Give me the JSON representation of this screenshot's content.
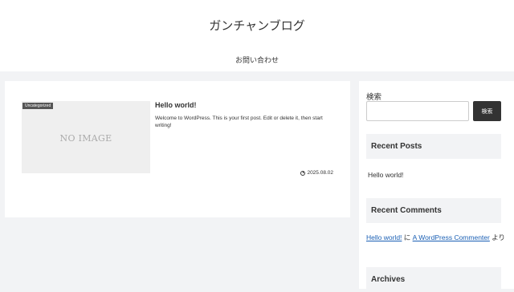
{
  "header": {
    "site_title": "ガンチャンブログ",
    "nav_items": [
      "お問い合わせ"
    ]
  },
  "posts": [
    {
      "category": "Uncategorized",
      "thumbnail_text": "NO IMAGE",
      "title": "Hello world!",
      "excerpt": "Welcome to WordPress. This is your first post. Edit or delete it, then start writing!",
      "date": "2025.08.02"
    }
  ],
  "sidebar": {
    "search": {
      "label": "検索",
      "placeholder": "",
      "button_label": "検索"
    },
    "recent_posts": {
      "heading": "Recent Posts",
      "items": [
        "Hello world!"
      ]
    },
    "recent_comments": {
      "heading": "Recent Comments",
      "items": [
        {
          "post_link": "Hello world!",
          "connector": " に ",
          "author_link": "A WordPress Commenter",
          "suffix": " より"
        }
      ]
    },
    "archives": {
      "heading": "Archives"
    }
  },
  "colors": {
    "page_background": "#f2f3f5",
    "link": "#1a5fb4",
    "search_button": "#333333",
    "category_badge": "#555555"
  }
}
